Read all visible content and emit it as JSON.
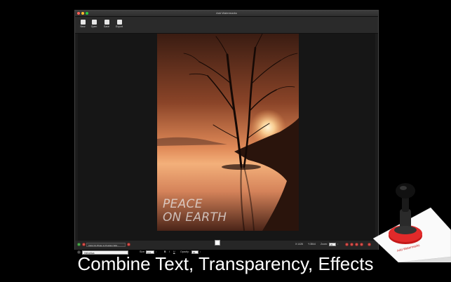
{
  "window": {
    "title": "Add Watermarks"
  },
  "toolbar": {
    "buttons": [
      {
        "label": "New",
        "icon": "new-document-icon"
      },
      {
        "label": "Open",
        "icon": "open-folder-icon"
      },
      {
        "label": "Save",
        "icon": "save-icon"
      },
      {
        "label": "Export",
        "icon": "export-icon"
      }
    ]
  },
  "watermark": {
    "line1": "PEACE",
    "line2": "ON EARTH"
  },
  "bottom": {
    "position_hint": "Click On Photo to Position Wat...",
    "font": "Helvetica",
    "size_label": "Size:",
    "size_value": "101",
    "opacity_label": "Opacity:",
    "opacity_value": "90",
    "x_value": "X:1426",
    "y_value": "Y:3844",
    "zoom_label": "Zoom:",
    "zoom_value": "20"
  },
  "stamp": {
    "text": "Add Watermarks"
  },
  "caption": "Combine Text, Transparency, Effects",
  "colors": {
    "accent_red": "#d9534f",
    "window_bg": "#1c1c1c"
  }
}
